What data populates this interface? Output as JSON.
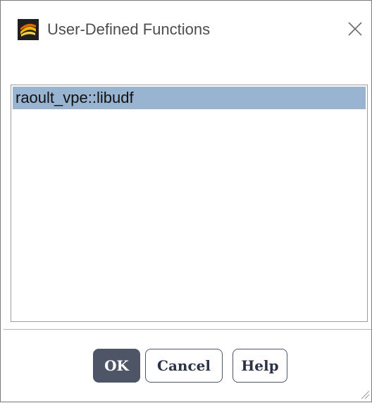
{
  "window": {
    "title": "User-Defined Functions",
    "app_icon": "ansys-fluent-icon",
    "close_icon": "close-icon"
  },
  "list": {
    "items": [
      {
        "label": "raoult_vpe::libudf",
        "selected": true
      }
    ]
  },
  "buttons": {
    "ok_label": "OK",
    "cancel_label": "Cancel",
    "help_label": "Help"
  },
  "colors": {
    "selection": "#99b4d1",
    "primary_button": "#4d5566",
    "title_text": "#4d4d4d"
  }
}
